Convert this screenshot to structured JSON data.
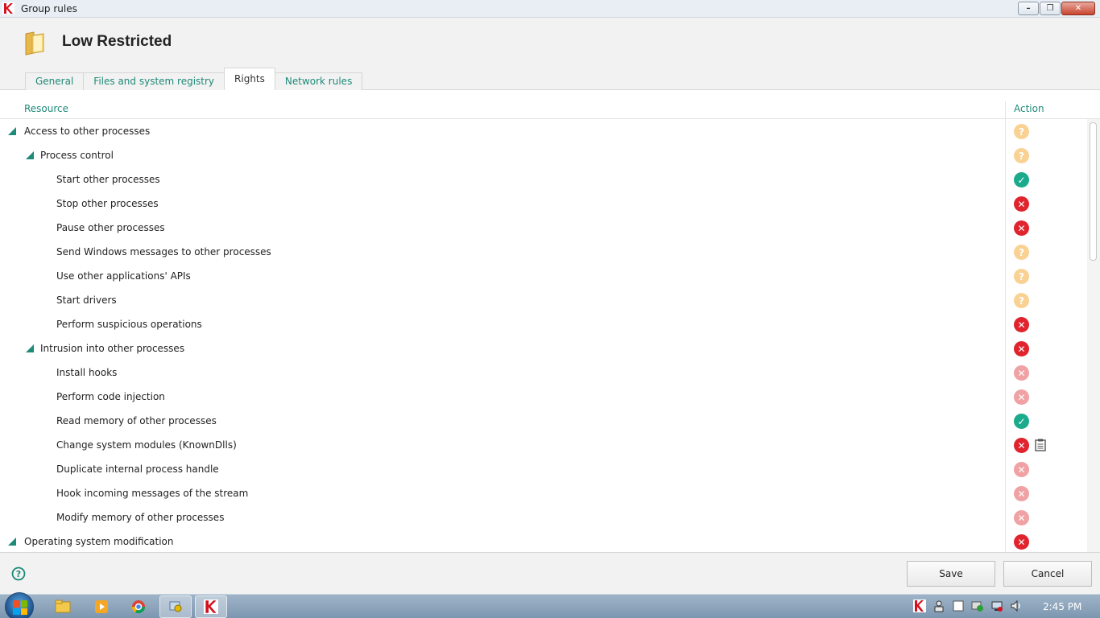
{
  "window": {
    "title": "Group rules"
  },
  "header": {
    "title": "Low Restricted"
  },
  "tabs": [
    {
      "label": "General",
      "active": false
    },
    {
      "label": "Files and system registry",
      "active": false
    },
    {
      "label": "Rights",
      "active": true
    },
    {
      "label": "Network rules",
      "active": false
    }
  ],
  "table": {
    "columns": {
      "resource": "Resource",
      "action": "Action"
    },
    "rows": [
      {
        "label": "Access to other processes",
        "level": 0,
        "expandable": true,
        "action": "ask"
      },
      {
        "label": "Process control",
        "level": 1,
        "expandable": true,
        "action": "ask"
      },
      {
        "label": "Start other processes",
        "level": 2,
        "expandable": false,
        "action": "allow"
      },
      {
        "label": "Stop other processes",
        "level": 2,
        "expandable": false,
        "action": "block"
      },
      {
        "label": "Pause other processes",
        "level": 2,
        "expandable": false,
        "action": "block"
      },
      {
        "label": "Send Windows messages to other processes",
        "level": 2,
        "expandable": false,
        "action": "ask"
      },
      {
        "label": "Use other applications' APIs",
        "level": 2,
        "expandable": false,
        "action": "ask"
      },
      {
        "label": "Start drivers",
        "level": 2,
        "expandable": false,
        "action": "ask"
      },
      {
        "label": "Perform suspicious operations",
        "level": 2,
        "expandable": false,
        "action": "block"
      },
      {
        "label": "Intrusion into other processes",
        "level": 1,
        "expandable": true,
        "action": "block"
      },
      {
        "label": "Install hooks",
        "level": 2,
        "expandable": false,
        "action": "block-inherited"
      },
      {
        "label": "Perform code injection",
        "level": 2,
        "expandable": false,
        "action": "block-inherited"
      },
      {
        "label": "Read memory of other processes",
        "level": 2,
        "expandable": false,
        "action": "allow"
      },
      {
        "label": "Change system modules (KnownDlls)",
        "level": 2,
        "expandable": false,
        "action": "block",
        "log": true
      },
      {
        "label": "Duplicate internal process handle",
        "level": 2,
        "expandable": false,
        "action": "block-inherited"
      },
      {
        "label": "Hook incoming messages of the stream",
        "level": 2,
        "expandable": false,
        "action": "block-inherited"
      },
      {
        "label": "Modify memory of other processes",
        "level": 2,
        "expandable": false,
        "action": "block-inherited"
      },
      {
        "label": "Operating system modification",
        "level": 0,
        "expandable": true,
        "action": "block"
      }
    ]
  },
  "footer": {
    "save_label": "Save",
    "cancel_label": "Cancel"
  },
  "taskbar": {
    "clock": "2:45 PM",
    "apps": [
      "explorer-icon",
      "media-player-icon",
      "chrome-icon",
      "network-tool-icon",
      "kaspersky-icon"
    ]
  },
  "colors": {
    "accent": "#1e8a78",
    "allow": "#1aaa8c",
    "block": "#e0232d",
    "block_inherited": "#f0a1a3",
    "ask": "#f9d293"
  }
}
